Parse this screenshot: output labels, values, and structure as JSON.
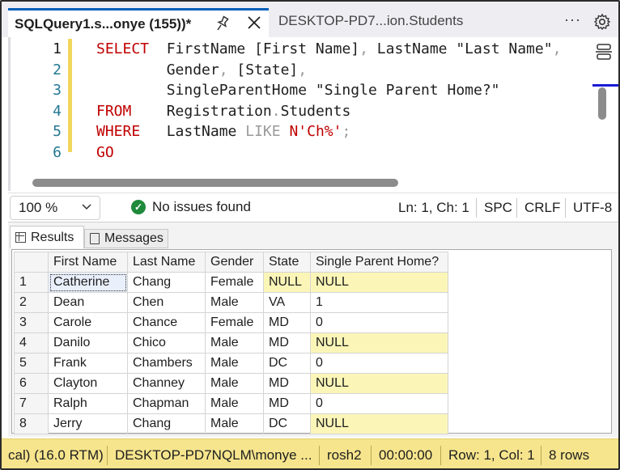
{
  "tabs": {
    "active_title": "SQLQuery1.s...onye (155))*",
    "inactive_title": "DESKTOP-PD7...ion.Students",
    "more_label": "···"
  },
  "editor": {
    "line_numbers": [
      "1",
      "2",
      "3",
      "4",
      "5",
      "6"
    ],
    "lines": [
      [
        {
          "t": "SELECT",
          "c": "kw"
        },
        {
          "t": "  FirstName [First Name]",
          "c": "ident"
        },
        {
          "t": ",",
          "c": "op"
        },
        {
          "t": " LastName ",
          "c": "ident"
        },
        {
          "t": "\"Last Name\"",
          "c": "ident"
        },
        {
          "t": ",",
          "c": "op"
        }
      ],
      [
        {
          "t": "        Gender",
          "c": "ident"
        },
        {
          "t": ",",
          "c": "op"
        },
        {
          "t": " [State]",
          "c": "ident"
        },
        {
          "t": ",",
          "c": "op"
        }
      ],
      [
        {
          "t": "        SingleParentHome \"Single Parent Home?\"",
          "c": "ident"
        }
      ],
      [
        {
          "t": "FROM",
          "c": "kw"
        },
        {
          "t": "    Registration",
          "c": "ident"
        },
        {
          "t": ".",
          "c": "op"
        },
        {
          "t": "Students",
          "c": "ident"
        }
      ],
      [
        {
          "t": "WHERE",
          "c": "kw"
        },
        {
          "t": "   LastName ",
          "c": "ident"
        },
        {
          "t": "LIKE",
          "c": "op"
        },
        {
          "t": " ",
          "c": "ident"
        },
        {
          "t": "N'Ch%'",
          "c": "str"
        },
        {
          "t": ";",
          "c": "op"
        }
      ],
      [
        {
          "t": "GO",
          "c": "kw"
        }
      ]
    ]
  },
  "status": {
    "zoom": "100 %",
    "issues": "No issues found",
    "position": "Ln: 1, Ch: 1",
    "whitespace": "SPC",
    "line_ending": "CRLF",
    "encoding": "UTF-8"
  },
  "results": {
    "tab_results": "Results",
    "tab_messages": "Messages",
    "columns": [
      "",
      "First Name",
      "Last Name",
      "Gender",
      "State",
      "Single Parent Home?"
    ],
    "rows": [
      [
        "1",
        "Catherine",
        "Chang",
        "Female",
        "NULL",
        "NULL"
      ],
      [
        "2",
        "Dean",
        "Chen",
        "Male",
        "VA",
        "1"
      ],
      [
        "3",
        "Carole",
        "Chance",
        "Female",
        "MD",
        "0"
      ],
      [
        "4",
        "Danilo",
        "Chico",
        "Male",
        "MD",
        "NULL"
      ],
      [
        "5",
        "Frank",
        "Chambers",
        "Male",
        "DC",
        "0"
      ],
      [
        "6",
        "Clayton",
        "Channey",
        "Male",
        "MD",
        "NULL"
      ],
      [
        "7",
        "Ralph",
        "Chapman",
        "Male",
        "MD",
        "0"
      ],
      [
        "8",
        "Jerry",
        "Chang",
        "Male",
        "DC",
        "NULL"
      ]
    ]
  },
  "bottom": {
    "version": "cal) (16.0 RTM)",
    "server": "DESKTOP-PD7NQLM\\monye ...",
    "database": "rosh2",
    "elapsed": "00:00:00",
    "rowcol": "Row: 1, Col: 1",
    "rows": "8 rows"
  },
  "colors": {
    "accent": "#005fb8",
    "keyword": "#c00000",
    "null_highlight": "#fbf6b8",
    "status_bar": "#f6e58d",
    "ok_green": "#1f8a3b"
  },
  "icons": [
    "pin-icon",
    "close-icon",
    "more-icon",
    "gear-icon",
    "split-editor-icon",
    "check-circle-icon",
    "chevron-down-icon",
    "grid-icon",
    "messages-icon"
  ]
}
